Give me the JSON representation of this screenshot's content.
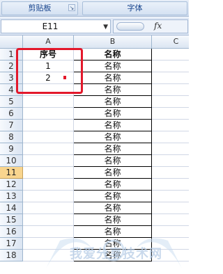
{
  "ribbon": {
    "clipboard_label": "剪贴板",
    "font_label": "字体"
  },
  "formula_bar": {
    "name_box": "E11",
    "fx_label": "fx"
  },
  "columns": [
    "A",
    "B",
    "C"
  ],
  "rows": [
    {
      "num": "1",
      "a": "序号",
      "b": "名称"
    },
    {
      "num": "2",
      "a": "1",
      "b": "名称"
    },
    {
      "num": "3",
      "a": "2",
      "b": "名称"
    },
    {
      "num": "4",
      "a": "",
      "b": "名称"
    },
    {
      "num": "5",
      "a": "",
      "b": "名称"
    },
    {
      "num": "6",
      "a": "",
      "b": "名称"
    },
    {
      "num": "7",
      "a": "",
      "b": "名称"
    },
    {
      "num": "8",
      "a": "",
      "b": "名称"
    },
    {
      "num": "9",
      "a": "",
      "b": "名称"
    },
    {
      "num": "10",
      "a": "",
      "b": "名称"
    },
    {
      "num": "11",
      "a": "",
      "b": "名称"
    },
    {
      "num": "12",
      "a": "",
      "b": "名称"
    },
    {
      "num": "13",
      "a": "",
      "b": "名称"
    },
    {
      "num": "14",
      "a": "",
      "b": "名称"
    },
    {
      "num": "15",
      "a": "",
      "b": "名称"
    },
    {
      "num": "16",
      "a": "",
      "b": "名称"
    },
    {
      "num": "17",
      "a": "",
      "b": "名称"
    },
    {
      "num": "18",
      "a": "",
      "b": "名称"
    }
  ],
  "active_row": "11",
  "watermark": "我爱分享技术网",
  "colors": {
    "highlight": "#e3182b",
    "active_header": "#f9d58e"
  }
}
